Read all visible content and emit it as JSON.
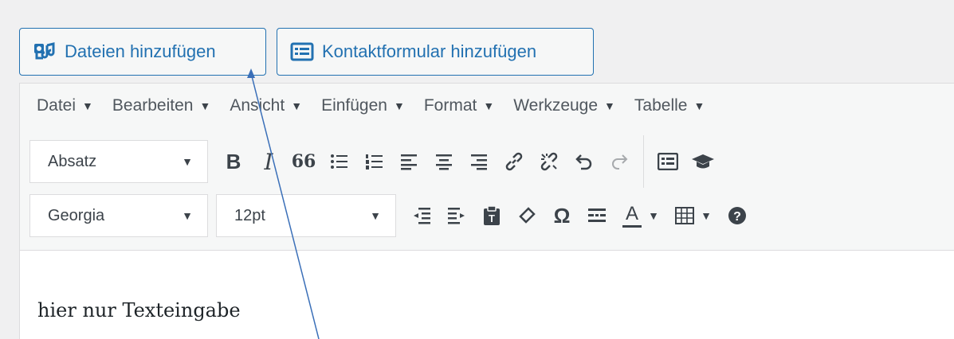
{
  "media_buttons": {
    "add_files": {
      "label": "Dateien hinzufügen",
      "icon": "media-files-icon"
    },
    "add_contact_form": {
      "label": "Kontaktformular hinzufügen",
      "icon": "form-icon"
    }
  },
  "menubar": {
    "items": [
      "Datei",
      "Bearbeiten",
      "Ansicht",
      "Einfügen",
      "Format",
      "Werkzeuge",
      "Tabelle"
    ],
    "caret": "▼"
  },
  "toolbar": {
    "row1": {
      "block_format": "Absatz",
      "buttons": [
        "bold-icon",
        "italic-icon",
        "blockquote-icon",
        "bullet-list-icon",
        "numbered-list-icon",
        "align-left-icon",
        "align-center-icon",
        "align-right-icon",
        "link-icon",
        "unlink-icon",
        "undo-icon",
        "redo-icon",
        "form-embed-icon",
        "graduation-cap-icon"
      ]
    },
    "row2": {
      "font_family": "Georgia",
      "font_size": "12pt",
      "buttons": [
        "outdent-icon",
        "indent-icon",
        "paste-as-text-icon",
        "clear-formatting-icon",
        "special-character-icon",
        "horizontal-line-icon",
        "text-color-icon",
        "table-icon",
        "help-icon"
      ]
    },
    "bold_glyph": "B",
    "italic_glyph": "I",
    "quote_glyph": "66",
    "omega_glyph": "Ω",
    "text_color_glyph": "A"
  },
  "content": {
    "text": "hier nur Texteingabe"
  },
  "colors": {
    "accent": "#2271b1",
    "toolbar_bg": "#f6f7f7",
    "annotation_line": "#3a6fb8"
  }
}
